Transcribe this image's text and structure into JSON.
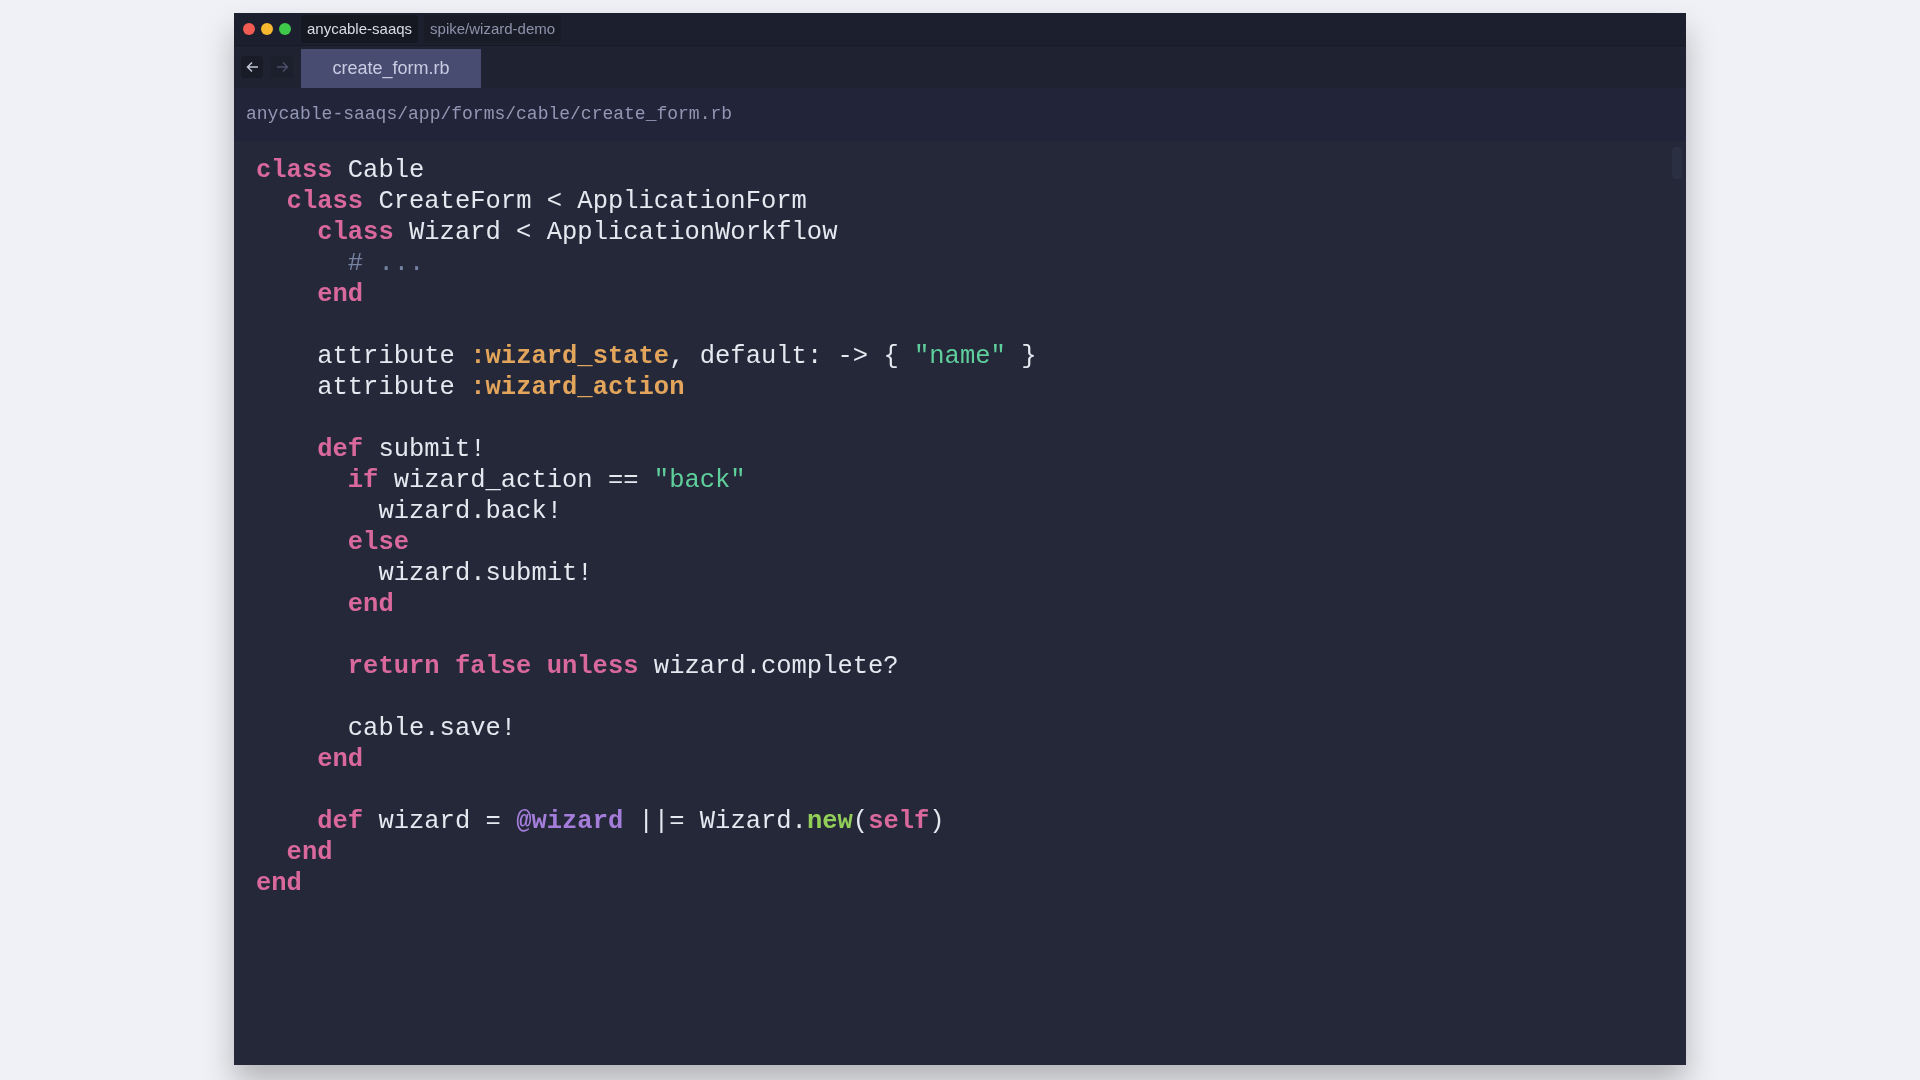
{
  "window": {
    "title_chips": [
      {
        "label": "anycable-saaqs",
        "selected": true
      },
      {
        "label": "spike/wizard-demo",
        "selected": false
      }
    ]
  },
  "nav": {
    "back_disabled": false,
    "forward_disabled": true
  },
  "tabs": [
    {
      "label": "create_form.rb",
      "selected": true
    }
  ],
  "path": "anycable-saaqs/app/forms/cable/create_form.rb",
  "code": [
    {
      "kind": "code",
      "tokens": [
        {
          "kind": "keyword",
          "s": "class"
        },
        {
          "kind": "plain",
          "s": " Cable"
        }
      ],
      "children": [
        {
          "kind": "code",
          "tokens": [
            {
              "kind": "keyword",
              "s": "class"
            },
            {
              "kind": "plain",
              "s": " CreateForm < ApplicationForm"
            }
          ],
          "children": [
            {
              "kind": "code",
              "tokens": [
                {
                  "kind": "keyword",
                  "s": "class"
                },
                {
                  "kind": "plain",
                  "s": " Wizard < ApplicationWorkflow"
                }
              ],
              "children": [
                {
                  "kind": "code",
                  "tokens": [
                    {
                      "kind": "comment",
                      "s": "# ..."
                    }
                  ]
                }
              ]
            },
            {
              "kind": "code",
              "tokens": [
                {
                  "kind": "keyword",
                  "s": "end"
                }
              ]
            },
            {
              "kind": "blank"
            },
            {
              "kind": "code",
              "tokens": [
                {
                  "kind": "plain",
                  "s": "attribute "
                },
                {
                  "kind": "symbol",
                  "s": ":wizard_state"
                },
                {
                  "kind": "plain",
                  "s": ", default: -> { "
                },
                {
                  "kind": "string",
                  "s": "\"name\""
                },
                {
                  "kind": "plain",
                  "s": " }"
                }
              ]
            },
            {
              "kind": "code",
              "tokens": [
                {
                  "kind": "plain",
                  "s": "attribute "
                },
                {
                  "kind": "symbol",
                  "s": ":wizard_action"
                }
              ]
            },
            {
              "kind": "blank"
            },
            {
              "kind": "code",
              "tokens": [
                {
                  "kind": "keyword",
                  "s": "def"
                },
                {
                  "kind": "plain",
                  "s": " submit!"
                }
              ],
              "children": [
                {
                  "kind": "code",
                  "tokens": [
                    {
                      "kind": "keyword",
                      "s": "if"
                    },
                    {
                      "kind": "plain",
                      "s": " wizard_action == "
                    },
                    {
                      "kind": "string",
                      "s": "\"back\""
                    }
                  ],
                  "children": [
                    {
                      "kind": "code",
                      "tokens": [
                        {
                          "kind": "plain",
                          "s": "wizard.back!"
                        }
                      ]
                    }
                  ]
                },
                {
                  "kind": "code",
                  "tokens": [
                    {
                      "kind": "keyword",
                      "s": "else"
                    }
                  ],
                  "children": [
                    {
                      "kind": "code",
                      "tokens": [
                        {
                          "kind": "plain",
                          "s": "wizard.submit!"
                        }
                      ]
                    }
                  ]
                },
                {
                  "kind": "code",
                  "tokens": [
                    {
                      "kind": "keyword",
                      "s": "end"
                    }
                  ]
                },
                {
                  "kind": "blank"
                },
                {
                  "kind": "code",
                  "tokens": [
                    {
                      "kind": "keyword",
                      "s": "return false unless"
                    },
                    {
                      "kind": "plain",
                      "s": " wizard.complete?"
                    }
                  ]
                },
                {
                  "kind": "blank"
                },
                {
                  "kind": "code",
                  "tokens": [
                    {
                      "kind": "plain",
                      "s": "cable.save!"
                    }
                  ]
                }
              ]
            },
            {
              "kind": "code",
              "tokens": [
                {
                  "kind": "keyword",
                  "s": "end"
                }
              ]
            },
            {
              "kind": "blank"
            },
            {
              "kind": "code",
              "tokens": [
                {
                  "kind": "keyword",
                  "s": "def"
                },
                {
                  "kind": "plain",
                  "s": " wizard = "
                },
                {
                  "kind": "ivar",
                  "s": "@wizard"
                },
                {
                  "kind": "plain",
                  "s": " ||= Wizard."
                },
                {
                  "kind": "method",
                  "s": "new"
                },
                {
                  "kind": "plain",
                  "s": "("
                },
                {
                  "kind": "keyword",
                  "s": "self"
                },
                {
                  "kind": "plain",
                  "s": ")"
                }
              ]
            }
          ]
        },
        {
          "kind": "code",
          "tokens": [
            {
              "kind": "keyword",
              "s": "end"
            }
          ]
        }
      ]
    },
    {
      "kind": "code",
      "tokens": [
        {
          "kind": "keyword",
          "s": "end"
        }
      ]
    }
  ]
}
